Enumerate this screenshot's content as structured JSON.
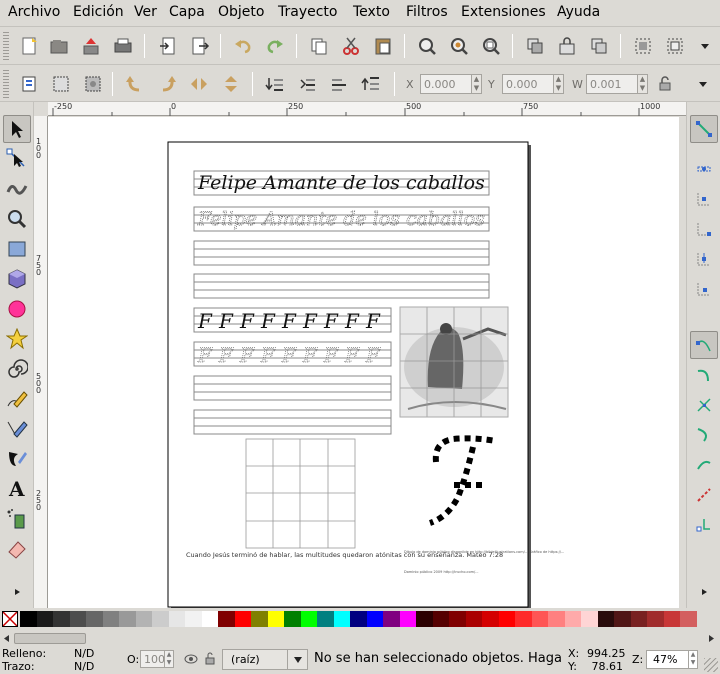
{
  "menu": [
    "Archivo",
    "Edición",
    "Ver",
    "Capa",
    "Objeto",
    "Trayecto",
    "Texto",
    "Filtros",
    "Extensiones",
    "Ayuda"
  ],
  "toolbar_icons": {
    "command": [
      "new-document-icon",
      "open-icon",
      "save-icon",
      "print-icon",
      "import-icon",
      "export-icon",
      "undo-icon",
      "redo-icon",
      "copy-icon",
      "cut-icon",
      "paste-icon",
      "zoom-selection-icon",
      "zoom-drawing-icon",
      "zoom-page-icon",
      "duplicate-icon",
      "clone-icon",
      "unlink-clone-icon",
      "group-icon",
      "ungroup-icon"
    ],
    "control": [
      "select-all-icon",
      "select-all-layers-icon",
      "deselect-icon",
      "rotate-ccw-icon",
      "rotate-cw-icon",
      "flip-horizontal-icon",
      "flip-vertical-icon",
      "lower-to-bottom-icon",
      "lower-icon",
      "raise-icon",
      "raise-to-top-icon"
    ]
  },
  "coords": {
    "x_label": "X",
    "x_value": "0.000",
    "y_label": "Y",
    "y_value": "0.000",
    "w_label": "W",
    "w_value": "0.001"
  },
  "hruler_labels": [
    "-250",
    "0",
    "250",
    "500",
    "750",
    "1000"
  ],
  "vruler_labels": [
    "1\n0\n0",
    "7\n5\n0",
    "5\n0\n0",
    "2\n5\n0"
  ],
  "tools": [
    "selector-icon",
    "node-editor-icon",
    "tweak-icon",
    "zoom-icon",
    "rectangle-icon",
    "3d-box-icon",
    "ellipse-icon",
    "star-icon",
    "spiral-icon",
    "pencil-icon",
    "pen-icon",
    "calligraphy-icon",
    "text-icon",
    "spray-icon",
    "eraser-icon"
  ],
  "document": {
    "title_line_1": "Felipe    Amante de los caballos",
    "title_line_2": "Felipe    Amante de los caballos",
    "letter": "F",
    "caption_1": "Cuando Jesús terminó de hablar, las multitudes quedaron atónitas con su enseñanza. Mateo 7:28",
    "caption_2": "Dibujo de dominio público disponible en http://bibleillustrations.com/... Gráfico de https://...",
    "caption_3": "Dominio público 2009 http://trucho.com/..."
  },
  "palette": [
    "#000000",
    "#1a1a1a",
    "#333333",
    "#4d4d4d",
    "#666666",
    "#808080",
    "#999999",
    "#b3b3b3",
    "#cccccc",
    "#e6e6e6",
    "#f2f2f2",
    "#ffffff",
    "#800000",
    "#ff0000",
    "#808000",
    "#ffff00",
    "#008000",
    "#00ff00",
    "#008080",
    "#00ffff",
    "#000080",
    "#0000ff",
    "#800080",
    "#ff00ff",
    "#2b0000",
    "#550000",
    "#800000",
    "#aa0000",
    "#d40000",
    "#ff0000",
    "#ff2a2a",
    "#ff5555",
    "#ff8080",
    "#ffaaaa",
    "#ffd5d5",
    "#280b0b",
    "#501616",
    "#782121",
    "#a02c2c",
    "#c83737",
    "#d35f5f"
  ],
  "status": {
    "fill_label": "Relleno:",
    "fill_value": "N/D",
    "stroke_label": "Trazo:",
    "stroke_value": "N/D",
    "opacity_label": "O:",
    "opacity_value": "100",
    "layer": "(raíz)",
    "message": "No se han seleccionado objetos. Haga",
    "x_label": "X:",
    "x_value": "994.25",
    "y_label": "Y:",
    "y_value": "78.61",
    "zoom_label": "Z:",
    "zoom_value": "47%"
  }
}
